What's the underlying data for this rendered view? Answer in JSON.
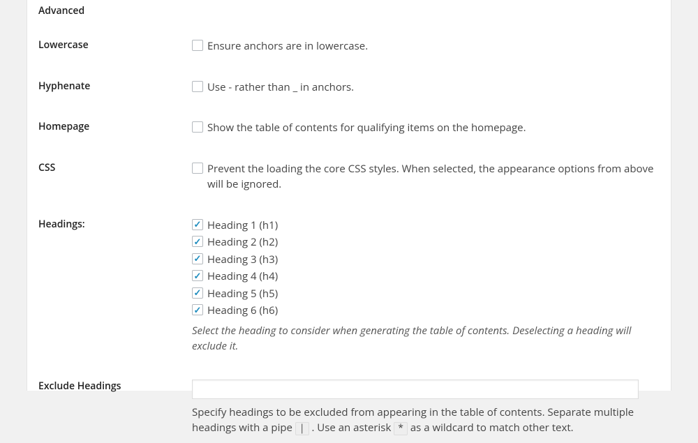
{
  "section_title": "Advanced",
  "lowercase": {
    "label": "Lowercase",
    "text": "Ensure anchors are in lowercase.",
    "checked": false
  },
  "hyphenate": {
    "label": "Hyphenate",
    "text": "Use - rather than _ in anchors.",
    "checked": false
  },
  "homepage": {
    "label": "Homepage",
    "text": "Show the table of contents for qualifying items on the homepage.",
    "checked": false
  },
  "css": {
    "label": "CSS",
    "text": "Prevent the loading the core CSS styles. When selected, the appearance options from above will be ignored.",
    "checked": false
  },
  "headings": {
    "label": "Headings:",
    "items": [
      {
        "label": "Heading 1 (h1)",
        "checked": true
      },
      {
        "label": "Heading 2 (h2)",
        "checked": true
      },
      {
        "label": "Heading 3 (h3)",
        "checked": true
      },
      {
        "label": "Heading 4 (h4)",
        "checked": true
      },
      {
        "label": "Heading 5 (h5)",
        "checked": true
      },
      {
        "label": "Heading 6 (h6)",
        "checked": true
      }
    ],
    "helper": "Select the heading to consider when generating the table of contents. Deselecting a heading will exclude it."
  },
  "exclude": {
    "label": "Exclude Headings",
    "value": "",
    "desc_pre": "Specify headings to be excluded from appearing in the table of contents. Separate multiple headings with a pipe ",
    "pipe_chip": "|",
    "desc_mid": " . Use an asterisk ",
    "asterisk_chip": "*",
    "desc_post": " as a wildcard to match other text."
  }
}
